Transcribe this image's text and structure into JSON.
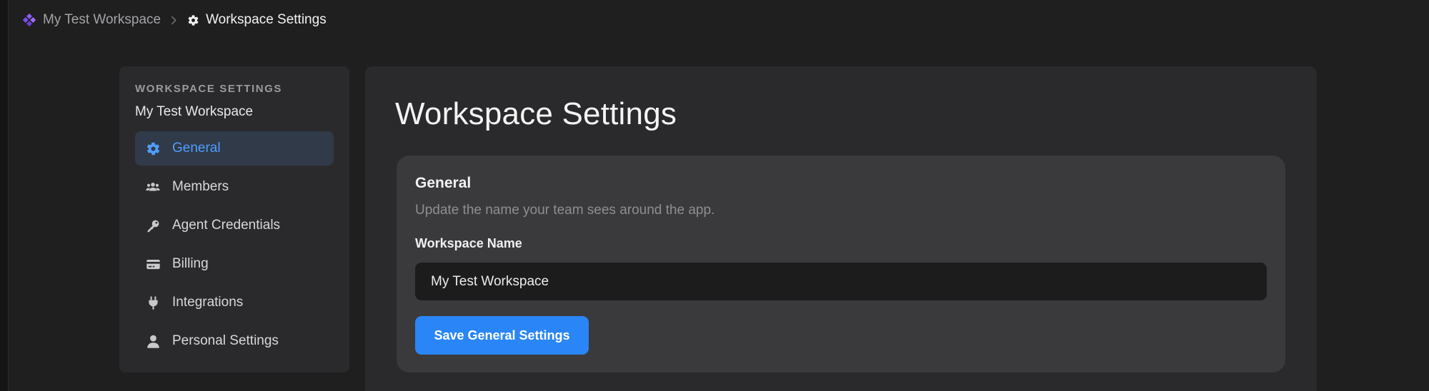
{
  "breadcrumb": {
    "workspace": "My Test Workspace",
    "current": "Workspace Settings",
    "workspace_icon": "workspace-diamond-icon",
    "separator_icon": "chevron-right-icon",
    "current_icon": "gear-icon"
  },
  "sidebar": {
    "section_label": "WORKSPACE SETTINGS",
    "workspace_name": "My Test Workspace",
    "items": [
      {
        "label": "General",
        "icon": "gear-icon",
        "active": true
      },
      {
        "label": "Members",
        "icon": "users-icon",
        "active": false
      },
      {
        "label": "Agent Credentials",
        "icon": "key-icon",
        "active": false
      },
      {
        "label": "Billing",
        "icon": "credit-card-icon",
        "active": false
      },
      {
        "label": "Integrations",
        "icon": "plug-icon",
        "active": false
      },
      {
        "label": "Personal Settings",
        "icon": "user-icon",
        "active": false
      }
    ]
  },
  "main": {
    "title": "Workspace Settings",
    "card": {
      "title": "General",
      "description": "Update the name your team sees around the app.",
      "field_label": "Workspace Name",
      "field_value": "My Test Workspace",
      "save_label": "Save General Settings"
    }
  },
  "colors": {
    "accent": "#2a86f6",
    "active_text": "#4f9dff",
    "workspace_icon": "#8b5cf6"
  }
}
